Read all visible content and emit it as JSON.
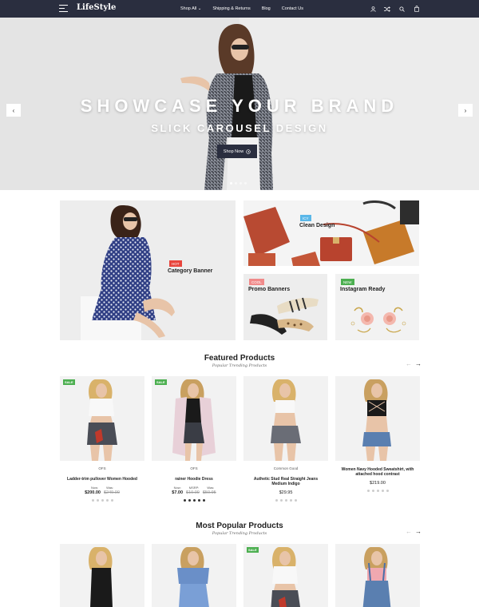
{
  "nav": {
    "logo": "LifeStyle",
    "links": [
      "Shop All",
      "Shipping & Returns",
      "Blog",
      "Contact Us"
    ],
    "icons": [
      "user-icon",
      "shuffle-icon",
      "search-icon",
      "bag-icon"
    ]
  },
  "hero": {
    "title": "SHOWCASE YOUR BRAND",
    "subtitle": "SLICK CAROUSEL DESIGN",
    "button": "Shop Now",
    "prev": "‹",
    "next": "›",
    "active_slide": 1,
    "slides": 4
  },
  "banners": {
    "category": {
      "badge": "HOT",
      "title": "Category Banner",
      "badge_color": "#e8453c"
    },
    "clean": {
      "badge": "ICY",
      "title": "Clean Design",
      "badge_color": "#5ab7e8"
    },
    "promo": {
      "badge": "COOL",
      "title": "Promo Banners",
      "badge_color": "#f08a8a"
    },
    "instagram": {
      "badge": "NEW",
      "title": "Instagram Ready",
      "badge_color": "#4caf50"
    }
  },
  "featured": {
    "title": "Featured Products",
    "subtitle": "Popular Trending Products",
    "prev": "←",
    "next": "→",
    "products": [
      {
        "sale": "SALE",
        "vendor": "OFS",
        "name": "Ladder-trim pullover Women Hooded",
        "labels": [
          "Now:",
          "Was:"
        ],
        "prices": [
          "$200.00",
          "$249.00"
        ]
      },
      {
        "sale": "SALE",
        "vendor": "OFS",
        "name": "rainer Hoodie Dress",
        "labels": [
          "Now:",
          "MSRP:",
          "Was:"
        ],
        "prices": [
          "$7.00",
          "$10.00",
          "$50.95"
        ]
      },
      {
        "sale": "",
        "vendor": "Common Good",
        "name": "Authetic Stud Real Straight Jeans Medium Indigo",
        "labels": [],
        "prices": [
          "$29.95"
        ]
      },
      {
        "sale": "",
        "vendor": "",
        "name": "Women Navy Hooded Sweatshirt, with attached hood contrast",
        "labels": [],
        "prices": [
          "$219.00"
        ]
      }
    ]
  },
  "popular": {
    "title": "Most Popular Products",
    "subtitle": "Popular Trending Products",
    "prev": "←",
    "next": "→",
    "products": [
      {
        "sale": ""
      },
      {
        "sale": ""
      },
      {
        "sale": "SALE"
      },
      {
        "sale": ""
      }
    ]
  },
  "colors": {
    "nav_bg": "#2a2e3f",
    "sale_badge": "#4caf50"
  }
}
